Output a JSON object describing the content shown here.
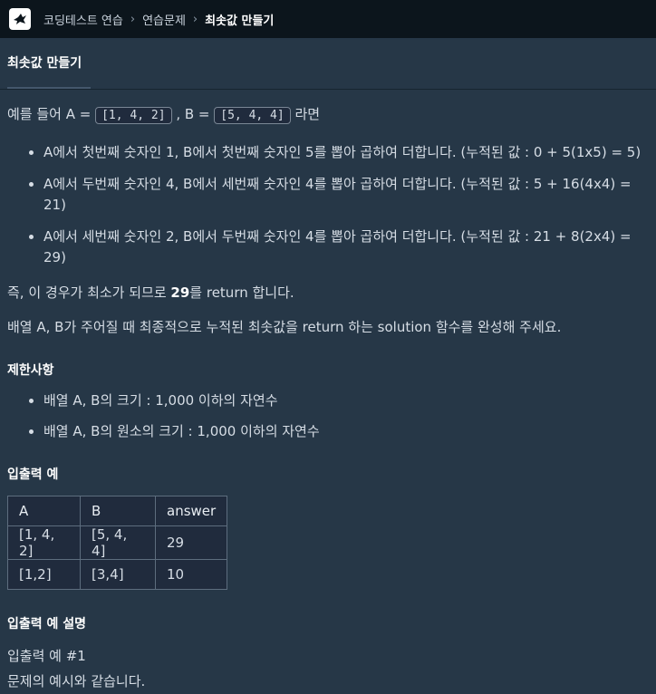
{
  "breadcrumb": {
    "items": [
      "코딩테스트 연습",
      "연습문제",
      "최솟값 만들기"
    ]
  },
  "tab": {
    "label": "최솟값 만들기"
  },
  "intro": {
    "prefix": "예를 들어 A = ",
    "a_code": "[1, 4, 2]",
    "mid": " , B = ",
    "b_code": "[5, 4, 4]",
    "suffix": " 라면"
  },
  "steps": [
    "A에서 첫번째 숫자인 1, B에서 첫번째 숫자인 5를 뽑아 곱하여 더합니다. (누적된 값 : 0 + 5(1x5) = 5)",
    "A에서 두번째 숫자인 4, B에서 세번째 숫자인 4를 뽑아 곱하여 더합니다. (누적된 값 : 5 + 16(4x4) = 21)",
    "A에서 세번째 숫자인 2, B에서 두번째 숫자인 4를 뽑아 곱하여 더합니다. (누적된 값 : 21 + 8(2x4) = 29)"
  ],
  "conclusion": {
    "prefix": "즉, 이 경우가 최소가 되므로 ",
    "bold": "29",
    "suffix": "를 return 합니다."
  },
  "task": "배열 A, B가 주어질 때 최종적으로 누적된 최솟값을 return 하는 solution 함수를 완성해 주세요.",
  "constraints": {
    "title": "제한사항",
    "items": [
      "배열 A, B의 크기 : 1,000 이하의 자연수",
      "배열 A, B의 원소의 크기 : 1,000 이하의 자연수"
    ]
  },
  "examples": {
    "title": "입출력 예",
    "headers": [
      "A",
      "B",
      "answer"
    ],
    "rows": [
      [
        "[1, 4, 2]",
        "[5, 4, 4]",
        "29"
      ],
      [
        "[1,2]",
        "[3,4]",
        "10"
      ]
    ]
  },
  "explanation": {
    "title": "입출력 예 설명",
    "case_title": "입출력 예 #1",
    "case_text": "문제의 예시와 같습니다."
  }
}
